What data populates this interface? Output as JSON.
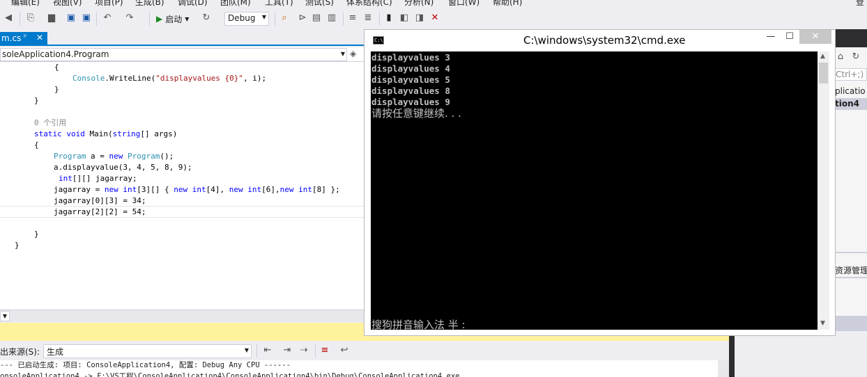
{
  "menubar": {
    "items": [
      "编辑(E)",
      "视图(V)",
      "项目(P)",
      "生成(B)",
      "调试(D)",
      "团队(M)",
      "工具(T)",
      "测试(S)",
      "体系结构(C)",
      "分析(N)",
      "窗口(W)",
      "帮助(H)",
      "登"
    ]
  },
  "toolbar": {
    "start_label": "启动",
    "config": "Debug"
  },
  "document_tab": {
    "title": "m.cs",
    "pin": "ᵖ",
    "close": "✕"
  },
  "navbar": {
    "scope": "soleApplication4.Program"
  },
  "editor": {
    "lines": [
      "{",
      "Console.WriteLine(\"displayvalues {0}\", i);",
      "}",
      "}",
      "0 个引用",
      "static void Main(string[] args)",
      "{",
      "Program a = new Program();",
      "a.displayvalue(3, 4, 5, 8, 9);",
      "int[][] jagarray;",
      "jagarray = new int[3][] { new int[4], new int[6],new int[8] };",
      "jagarray[0][3] = 34;",
      "jagarray[2][2] = 54;",
      "}",
      "}"
    ]
  },
  "output": {
    "source_label": "出来源(S):",
    "source_value": "生成",
    "lines": [
      "--- 已启动生成: 项目: ConsoleApplication4, 配置: Debug Any CPU ------",
      "onsoleApplication4 -> F:\\VS工程\\ConsoleApplication4\\ConsoleApplication4\\bin\\Debug\\ConsoleApplication4.exe"
    ]
  },
  "right_panel": {
    "lines": [
      "Ctrl+;)",
      "plicatio",
      "tion4",
      "资源管理"
    ]
  },
  "cmd": {
    "title": "C:\\windows\\system32\\cmd.exe",
    "icon_text": "C:\\",
    "minimize": "—",
    "maximize": "☐",
    "close": "✕",
    "output_lines": [
      "displayvalues 3",
      "displayvalues 4",
      "displayvalues 5",
      "displayvalues 8",
      "displayvalues 9"
    ],
    "prompt": "请按任意键继续. . .",
    "ime_status": "搜狗拼音输入法 半 :"
  }
}
